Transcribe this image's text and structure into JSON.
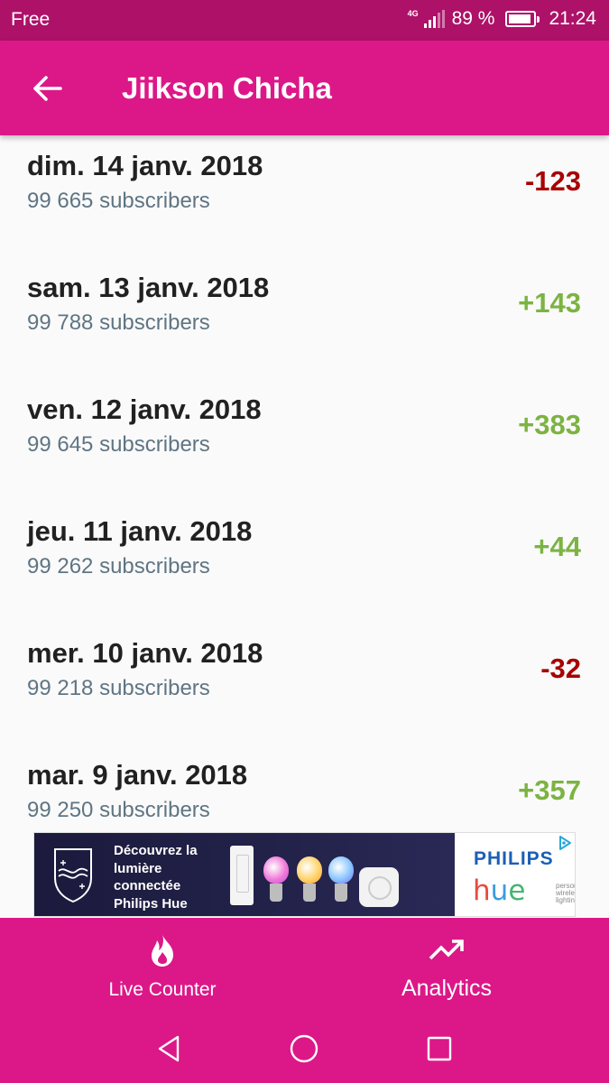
{
  "status_bar": {
    "carrier": "Free",
    "network": "4G",
    "battery": "89 %",
    "battery_level": 0.89,
    "time": "21:24"
  },
  "app_bar": {
    "title": "Jiikson Chicha",
    "back_icon": "arrow-left-icon"
  },
  "history": [
    {
      "date": "dim. 14 janv. 2018",
      "subscribers": "99 665 subscribers",
      "delta": "-123",
      "trend": "negative"
    },
    {
      "date": "sam. 13 janv. 2018",
      "subscribers": "99 788 subscribers",
      "delta": "+143",
      "trend": "positive"
    },
    {
      "date": "ven. 12 janv. 2018",
      "subscribers": "99 645 subscribers",
      "delta": "+383",
      "trend": "positive"
    },
    {
      "date": "jeu. 11 janv. 2018",
      "subscribers": "99 262 subscribers",
      "delta": "+44",
      "trend": "positive"
    },
    {
      "date": "mer. 10 janv. 2018",
      "subscribers": "99 218 subscribers",
      "delta": "-32",
      "trend": "negative"
    },
    {
      "date": "mar. 9 janv. 2018",
      "subscribers": "99 250 subscribers",
      "delta": "+357",
      "trend": "positive"
    }
  ],
  "ad": {
    "headline": "Découvrez la lumière connectée Philips Hue",
    "brand": "PHILIPS",
    "product_h": "h",
    "product_u": "u",
    "product_e": "e",
    "tagline": "personal wireless lighting",
    "icons": [
      "philips-shield-icon",
      "ad-choices-icon"
    ]
  },
  "bottom_nav": {
    "live_label": "Live Counter",
    "live_icon": "flame-icon",
    "analytics_label": "Analytics",
    "analytics_icon": "trending-up-icon"
  },
  "system_nav": {
    "icons": [
      "back-triangle-icon",
      "home-circle-icon",
      "recents-square-icon"
    ]
  },
  "colors": {
    "status_bar": "#ad1268",
    "primary": "#dc1888",
    "positive": "#7cb342",
    "negative": "#a80000",
    "subtext": "#5f7583"
  }
}
